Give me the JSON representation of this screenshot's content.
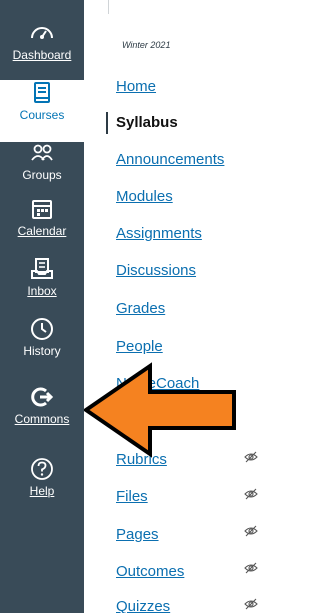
{
  "global_nav": {
    "items": [
      {
        "label": "Dashboard",
        "icon": "dashboard-icon"
      },
      {
        "label": "Courses",
        "icon": "courses-icon"
      },
      {
        "label": "Groups",
        "icon": "groups-icon"
      },
      {
        "label": "Calendar",
        "icon": "calendar-icon"
      },
      {
        "label": "Inbox",
        "icon": "inbox-icon"
      },
      {
        "label": "History",
        "icon": "history-icon"
      },
      {
        "label": "Commons",
        "icon": "commons-icon"
      },
      {
        "label": "Help",
        "icon": "help-icon"
      }
    ],
    "active_label": "Courses"
  },
  "course": {
    "term": "Winter 2021"
  },
  "course_nav": {
    "items": [
      {
        "label": "Home"
      },
      {
        "label": "Syllabus",
        "active": true
      },
      {
        "label": "Announcements"
      },
      {
        "label": "Modules"
      },
      {
        "label": "Assignments"
      },
      {
        "label": "Discussions"
      },
      {
        "label": "Grades"
      },
      {
        "label": "People"
      },
      {
        "label": "NameCoach"
      },
      {
        "label": "Rubrics",
        "hidden": true
      },
      {
        "label": "Files",
        "hidden": true
      },
      {
        "label": "Pages",
        "hidden": true
      },
      {
        "label": "Outcomes",
        "hidden": true
      },
      {
        "label": "Quizzes",
        "hidden": true
      }
    ]
  },
  "overlay": {
    "arrow_color": "#f58220",
    "arrow_outline": "#000000"
  },
  "colors": {
    "nav_bg": "#394b58",
    "link": "#0b6fb0"
  }
}
